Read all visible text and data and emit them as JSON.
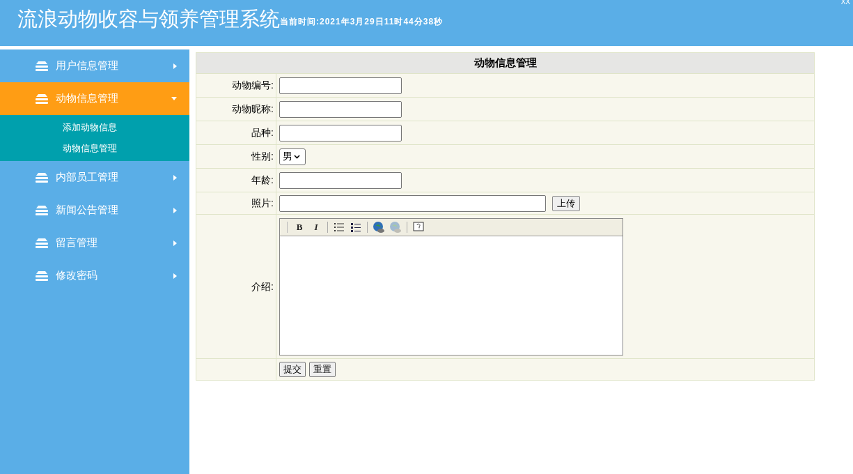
{
  "header": {
    "title": "流浪动物收容与领养管理系统",
    "time": "当前时间:2021年3月29日11时44分38秒",
    "corner": "XX"
  },
  "sidebar": {
    "items": [
      {
        "label": "用户信息管理",
        "expanded": false
      },
      {
        "label": "动物信息管理",
        "expanded": true,
        "children": [
          {
            "label": "添加动物信息"
          },
          {
            "label": "动物信息管理"
          }
        ]
      },
      {
        "label": "内部员工管理",
        "expanded": false
      },
      {
        "label": "新闻公告管理",
        "expanded": false
      },
      {
        "label": "留言管理",
        "expanded": false
      },
      {
        "label": "修改密码",
        "expanded": false
      }
    ]
  },
  "form": {
    "title": "动物信息管理",
    "fields": [
      {
        "kind": "text",
        "label": "动物编号:"
      },
      {
        "kind": "text",
        "label": "动物昵称:"
      },
      {
        "kind": "text",
        "label": "品种:"
      },
      {
        "kind": "select",
        "label": "性别:",
        "value": "男"
      },
      {
        "kind": "text",
        "label": "年龄:"
      },
      {
        "kind": "upload",
        "label": "照片:",
        "button": "上传"
      },
      {
        "kind": "editor",
        "label": "介绍:",
        "tools": [
          {
            "kind": "bold",
            "label": "B"
          },
          {
            "kind": "italic",
            "label": "I"
          },
          {
            "kind": "ordered"
          },
          {
            "kind": "unordered"
          },
          {
            "kind": "link"
          },
          {
            "kind": "unlink",
            "disabled": true
          },
          {
            "kind": "help"
          }
        ]
      }
    ],
    "buttons": [
      "提交",
      "重置"
    ]
  }
}
